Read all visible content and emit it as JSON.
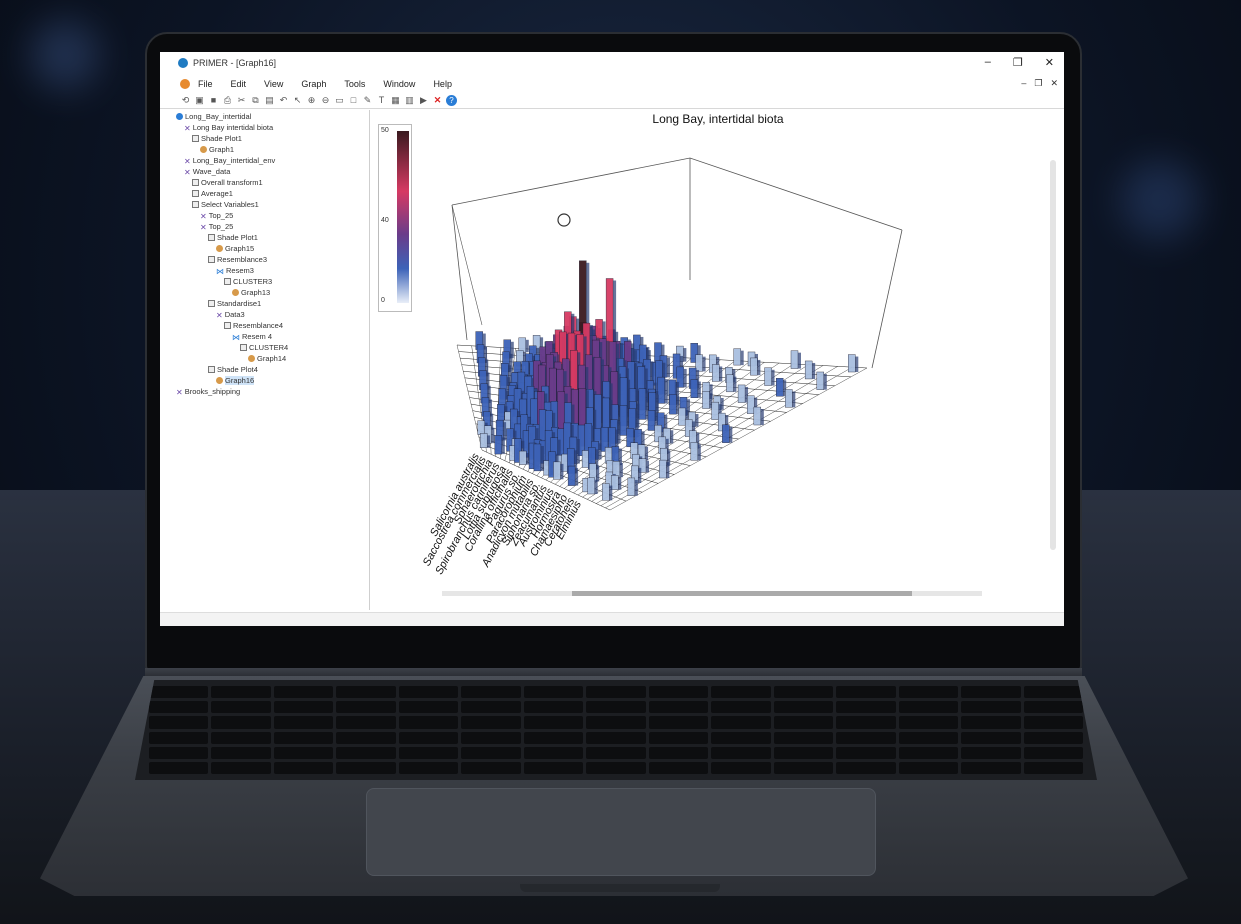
{
  "window": {
    "title": "PRIMER - [Graph16]",
    "controls": [
      "–",
      "❐",
      "✕"
    ],
    "mdi_controls": [
      "–",
      "❐",
      "✕"
    ]
  },
  "menu": [
    "File",
    "Edit",
    "View",
    "Graph",
    "Tools",
    "Window",
    "Help"
  ],
  "toolbar_icons": [
    "open-icon",
    "save-icon",
    "disk-icon",
    "print-icon",
    "cut-icon",
    "copy-icon",
    "paste-icon",
    "undo-icon",
    "pointer-icon",
    "zoom-in-icon",
    "zoom-out-icon",
    "label-icon",
    "box-icon",
    "edit-icon",
    "text-icon",
    "grid-icon",
    "graph-icon",
    "run-icon",
    "stop-icon",
    "help-icon"
  ],
  "tree": [
    {
      "label": "Long_Bay_intertidal",
      "icon": "workspace",
      "level": 0
    },
    {
      "label": "Long Bay intertidal biota",
      "icon": "x",
      "level": 1
    },
    {
      "label": "Shade Plot1",
      "icon": "box",
      "level": 2
    },
    {
      "label": "Graph1",
      "icon": "graph",
      "level": 3
    },
    {
      "label": "Long_Bay_intertidal_env",
      "icon": "x",
      "level": 1
    },
    {
      "label": "Wave_data",
      "icon": "x",
      "level": 1
    },
    {
      "label": "Overall transform1",
      "icon": "box",
      "level": 2
    },
    {
      "label": "Average1",
      "icon": "box",
      "level": 2
    },
    {
      "label": "Select Variables1",
      "icon": "box",
      "level": 2
    },
    {
      "label": "Top_25",
      "icon": "x",
      "level": 3
    },
    {
      "label": "Top_25",
      "icon": "x",
      "level": 3
    },
    {
      "label": "Shade Plot1",
      "icon": "box",
      "level": 4
    },
    {
      "label": "Graph15",
      "icon": "graph",
      "level": 5
    },
    {
      "label": "Resemblance3",
      "icon": "box",
      "level": 4
    },
    {
      "label": "Resem3",
      "icon": "bfly",
      "level": 5
    },
    {
      "label": "CLUSTER3",
      "icon": "box",
      "level": 6
    },
    {
      "label": "Graph13",
      "icon": "graph",
      "level": 7
    },
    {
      "label": "Standardise1",
      "icon": "box",
      "level": 4
    },
    {
      "label": "Data3",
      "icon": "x",
      "level": 5
    },
    {
      "label": "Resemblance4",
      "icon": "box",
      "level": 6
    },
    {
      "label": "Resem 4",
      "icon": "bfly",
      "level": 7
    },
    {
      "label": "CLUSTER4",
      "icon": "box",
      "level": 8
    },
    {
      "label": "Graph14",
      "icon": "graph",
      "level": 9
    },
    {
      "label": "Shade Plot4",
      "icon": "box",
      "level": 4
    },
    {
      "label": "Graph16",
      "icon": "graph",
      "level": 5,
      "selected": true
    },
    {
      "label": "Brooks_shipping",
      "icon": "x",
      "level": 0
    }
  ],
  "chart_data": {
    "type": "3d-bar",
    "title": "Long Bay, intertidal biota",
    "colorbar": {
      "ticks": [
        "50",
        "40",
        "0"
      ],
      "colors": [
        "#3a1a1f",
        "#d63a63",
        "#6a3c8a",
        "#3d63b8",
        "#e8eef8"
      ]
    },
    "species_labels": [
      "Salicornia australis",
      "Saccostrea commercialis",
      "Sphaerotrichia",
      "Spirobranchus cariniferus",
      "Lottia subrugosa",
      "Corallina officinalis",
      "Pagurus sp.",
      "Paracorophium",
      "Anadicyon mutabilis",
      "Siphonaria sp.",
      "Zeacumantus",
      "Austrominius",
      "Hormosira",
      "Chamaesipho",
      "Ceratoneis",
      "Elminius"
    ]
  }
}
